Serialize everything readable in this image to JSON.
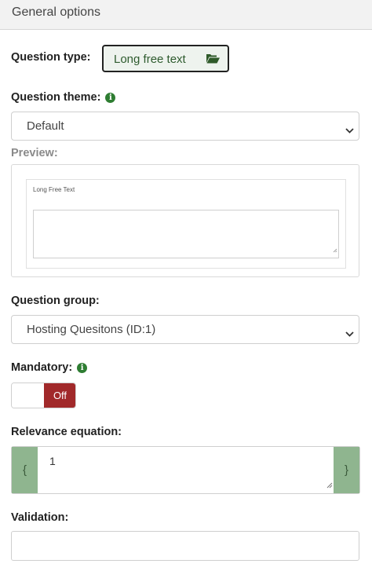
{
  "panel": {
    "title": "General options"
  },
  "question_type": {
    "label": "Question type:",
    "value": "Long free text",
    "icon": "folder-open-icon"
  },
  "question_theme": {
    "label": "Question theme:",
    "info_icon": "info-circle-icon",
    "selected": "Default"
  },
  "preview": {
    "label": "Preview:",
    "question_title": "Long Free Text"
  },
  "question_group": {
    "label": "Question group:",
    "selected": "Hosting Quesitons (ID:1)"
  },
  "mandatory": {
    "label": "Mandatory:",
    "info_icon": "info-circle-icon",
    "toggle_label": "Off",
    "state": "off"
  },
  "relevance": {
    "label": "Relevance equation:",
    "left_brace": "{",
    "right_brace": "}",
    "value": "1"
  },
  "validation": {
    "label": "Validation:",
    "value": ""
  },
  "colors": {
    "accent_green": "#2e7d32",
    "addon_green": "#8fb58f",
    "toggle_off_red": "#a1292a"
  }
}
